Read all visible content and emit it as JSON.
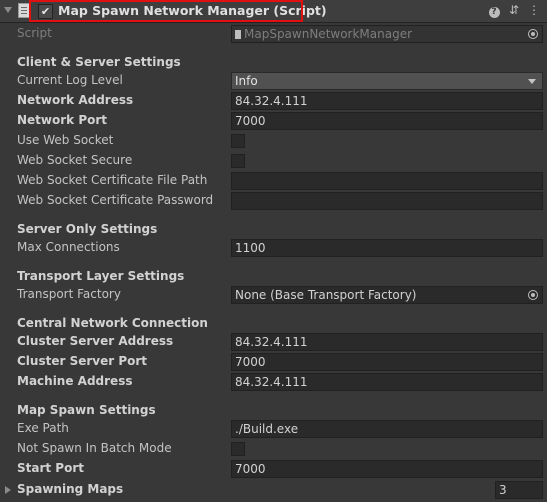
{
  "component": {
    "title": "Map Spawn Network Manager (Script)",
    "enabled_check": "✔"
  },
  "script_row": {
    "label": "Script",
    "value": "MapSpawnNetworkManager"
  },
  "client_server": {
    "heading": "Client & Server Settings",
    "log_level_label": "Current Log Level",
    "log_level_value": "Info",
    "network_address_label": "Network Address",
    "network_address_value": "84.32.4.111",
    "network_port_label": "Network Port",
    "network_port_value": "7000",
    "use_web_socket_label": "Use Web Socket",
    "web_socket_secure_label": "Web Socket Secure",
    "cert_path_label": "Web Socket Certificate File Path",
    "cert_path_value": "",
    "cert_password_label": "Web Socket Certificate Password",
    "cert_password_value": ""
  },
  "server_only": {
    "heading": "Server Only Settings",
    "max_connections_label": "Max Connections",
    "max_connections_value": "1100"
  },
  "transport": {
    "heading": "Transport Layer Settings",
    "factory_label": "Transport Factory",
    "factory_value": "None (Base Transport Factory)"
  },
  "central": {
    "heading": "Central Network Connection",
    "cluster_address_label": "Cluster Server Address",
    "cluster_address_value": "84.32.4.111",
    "cluster_port_label": "Cluster Server Port",
    "cluster_port_value": "7000",
    "machine_address_label": "Machine Address",
    "machine_address_value": "84.32.4.111"
  },
  "map_spawn": {
    "heading": "Map Spawn Settings",
    "exe_path_label": "Exe Path",
    "exe_path_value": "./Build.exe",
    "not_spawn_label": "Not Spawn In Batch Mode",
    "start_port_label": "Start Port",
    "start_port_value": "7000",
    "spawning_maps_label": "Spawning Maps",
    "spawning_maps_count": "3"
  }
}
